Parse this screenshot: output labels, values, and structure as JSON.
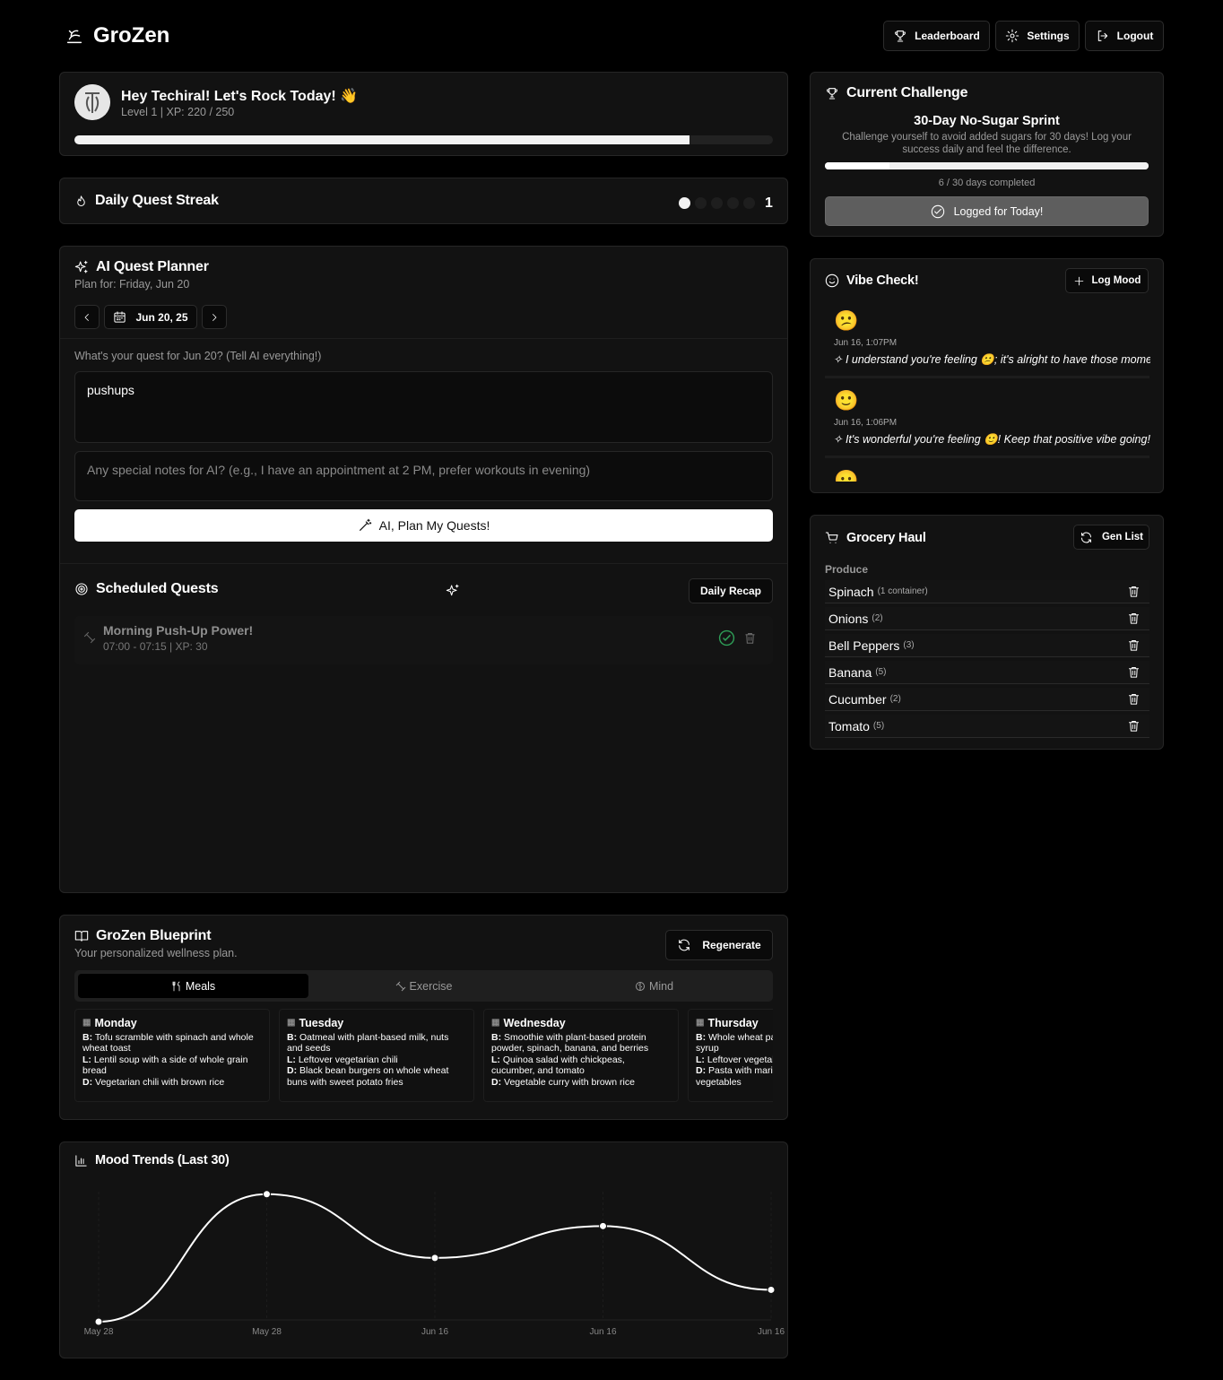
{
  "app": {
    "name": "GroZen"
  },
  "header": {
    "leaderboard_label": "Leaderboard",
    "settings_label": "Settings",
    "logout_label": "Logout"
  },
  "profile": {
    "greeting": "Hey Techiral! Let's Rock Today! 👋",
    "level_text": "Level 1 | XP: 220 / 250",
    "xp_progress": 0.88
  },
  "streak": {
    "title": "Daily Quest Streak",
    "count": "1",
    "filled_dots": 1,
    "total_dots": 5
  },
  "planner": {
    "title": "AI Quest Planner",
    "plan_for": "Plan for: Friday, Jun 20",
    "date_label": "Jun 20, 25",
    "quest_prompt": "What's your quest for Jun 20? (Tell AI everything!)",
    "quest_value": "pushups",
    "notes_placeholder": "Any special notes for AI? (e.g., I have an appointment at 2 PM, prefer workouts in evening)",
    "plan_button": "AI, Plan My Quests!"
  },
  "scheduled": {
    "title": "Scheduled Quests",
    "recap_button": "Daily Recap",
    "quests": [
      {
        "name": "Morning Push-Up Power!",
        "meta": "07:00 - 07:15 | XP: 30"
      }
    ]
  },
  "challenge": {
    "section_title": "Current Challenge",
    "name": "30-Day No-Sugar Sprint",
    "description": "Challenge yourself to avoid added sugars for 30 days! Log your success daily and feel the difference.",
    "progress_text": "6 / 30 days completed",
    "progress": 0.2,
    "logged_button": "Logged for Today!"
  },
  "vibe": {
    "title": "Vibe Check!",
    "log_button": "Log Mood",
    "entries": [
      {
        "emoji": "😕",
        "time": "Jun 16, 1:07PM",
        "message": "I understand you're feeling 😕; it's alright to have those moments."
      },
      {
        "emoji": "🙂",
        "time": "Jun 16, 1:06PM",
        "message": "It's wonderful you're feeling 🙂! Keep that positive vibe going!"
      },
      {
        "emoji": "😐"
      }
    ]
  },
  "grocery": {
    "title": "Grocery Haul",
    "gen_button": "Gen List",
    "category": "Produce",
    "items": [
      {
        "name": "Spinach",
        "qty": "(1 container)"
      },
      {
        "name": "Onions",
        "qty": "(2)"
      },
      {
        "name": "Bell Peppers",
        "qty": "(3)"
      },
      {
        "name": "Banana",
        "qty": "(5)"
      },
      {
        "name": "Cucumber",
        "qty": "(2)"
      },
      {
        "name": "Tomato",
        "qty": "(5)"
      }
    ]
  },
  "blueprint": {
    "title": "GroZen Blueprint",
    "subtitle": "Your personalized wellness plan.",
    "regen_button": "Regenerate",
    "tabs": [
      "Meals",
      "Exercise",
      "Mind"
    ],
    "days": [
      {
        "day": "Monday",
        "b": "Tofu scramble with spinach and whole wheat toast",
        "l": "Lentil soup with a side of whole grain bread",
        "d": "Vegetarian chili with brown rice"
      },
      {
        "day": "Tuesday",
        "b": "Oatmeal with plant-based milk, nuts and seeds",
        "l": "Leftover vegetarian chili",
        "d": "Black bean burgers on whole wheat buns with sweet potato fries"
      },
      {
        "day": "Wednesday",
        "b": "Smoothie with plant-based protein powder, spinach, banana, and berries",
        "l": "Quinoa salad with chickpeas, cucumber, and tomato",
        "d": "Vegetable curry with brown rice"
      },
      {
        "day": "Thursday",
        "b": "Whole wheat pancakes with maple syrup",
        "l": "Leftover vegetable curry",
        "d": "Pasta with marinara sauce and vegetables"
      }
    ]
  },
  "mood": {
    "title": "Mood Trends (Last 30)"
  },
  "chart_data": {
    "type": "line",
    "title": "Mood Trends (Last 30)",
    "categories": [
      "May 28",
      "May 28",
      "Jun 16",
      "Jun 16",
      "Jun 16"
    ],
    "values": [
      1,
      5,
      3,
      4,
      2
    ],
    "ylim": [
      1,
      5.5
    ],
    "grid": true
  }
}
